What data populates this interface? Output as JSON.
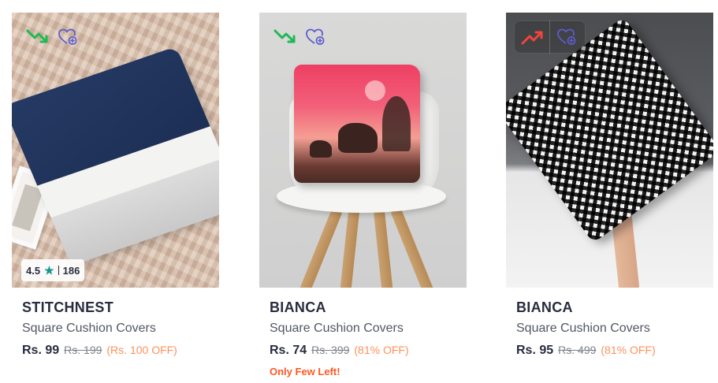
{
  "products": [
    {
      "brand": "STITCHNEST",
      "title": "Square Cushion Covers",
      "price": "Rs. 99",
      "mrp": "Rs. 199",
      "discount": "(Rs. 100 OFF)",
      "rating": {
        "value": "4.5",
        "count": "186"
      },
      "trend": "down",
      "trend_icon": "trend-down-icon",
      "wishlist_icon": "wishlist-add-icon",
      "stock_note": ""
    },
    {
      "brand": "BIANCA",
      "title": "Square Cushion Covers",
      "price": "Rs. 74",
      "mrp": "Rs. 399",
      "discount": "(81% OFF)",
      "trend": "down",
      "trend_icon": "trend-down-icon",
      "wishlist_icon": "wishlist-add-icon",
      "stock_note": "Only Few Left!"
    },
    {
      "brand": "BIANCA",
      "title": "Square Cushion Covers",
      "price": "Rs. 95",
      "mrp": "Rs. 499",
      "discount": "(81% OFF)",
      "trend": "up",
      "trend_icon": "trend-up-icon",
      "wishlist_icon": "wishlist-add-icon",
      "stock_note": ""
    }
  ],
  "colors": {
    "trend_down": "#1db954",
    "trend_up": "#f1453d",
    "wishlist": "#5c5ccf",
    "rating_star": "#14958f",
    "discount": "#ff905a",
    "stock_warning": "#ff5722"
  }
}
